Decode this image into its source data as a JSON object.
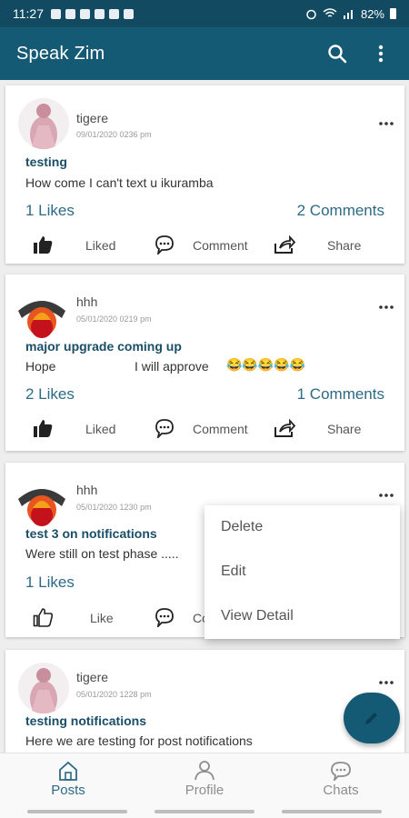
{
  "status_bar": {
    "time": "11:27",
    "battery": "82%"
  },
  "app_bar": {
    "title": "Speak Zim",
    "search_icon": "search-icon",
    "overflow_icon": "more-vert-icon"
  },
  "posts": [
    {
      "username": "tigere",
      "date": "09/01/2020 0236 pm",
      "title": "testing",
      "body": "How come I can't text u ikuramba",
      "likes": "1 Likes",
      "comments": "2 Comments",
      "like_label": "Liked",
      "comment_label": "Comment",
      "share_label": "Share"
    },
    {
      "username": "hhh",
      "date": "05/01/2020 0219 pm",
      "title": "major upgrade coming up",
      "body_start": "Hope",
      "body_end": "I will approve",
      "emojis": "😂😂😂😂😂",
      "likes": "2 Likes",
      "comments": "1 Comments",
      "like_label": "Liked",
      "comment_label": "Comment",
      "share_label": "Share"
    },
    {
      "username": "hhh",
      "date": "05/01/2020 1230 pm",
      "title": "test 3 on notifications",
      "body": "Were still on test phase .....",
      "likes": "1 Likes",
      "like_label": "Like",
      "comment_label_partial": "Co"
    },
    {
      "username": "tigere",
      "date": "05/01/2020 1228 pm",
      "title": "testing notifications",
      "body": "Here we are testing for post notifications"
    }
  ],
  "context_menu": {
    "items": [
      "Delete",
      "Edit",
      "View Detail"
    ]
  },
  "bottom_nav": {
    "items": [
      {
        "label": "Posts",
        "icon": "home-icon",
        "active": true
      },
      {
        "label": "Profile",
        "icon": "person-icon",
        "active": false
      },
      {
        "label": "Chats",
        "icon": "chat-icon",
        "active": false
      }
    ]
  },
  "colors": {
    "primary": "#155a74",
    "status_bar": "#114a61",
    "accent_text": "#2e6a85"
  }
}
